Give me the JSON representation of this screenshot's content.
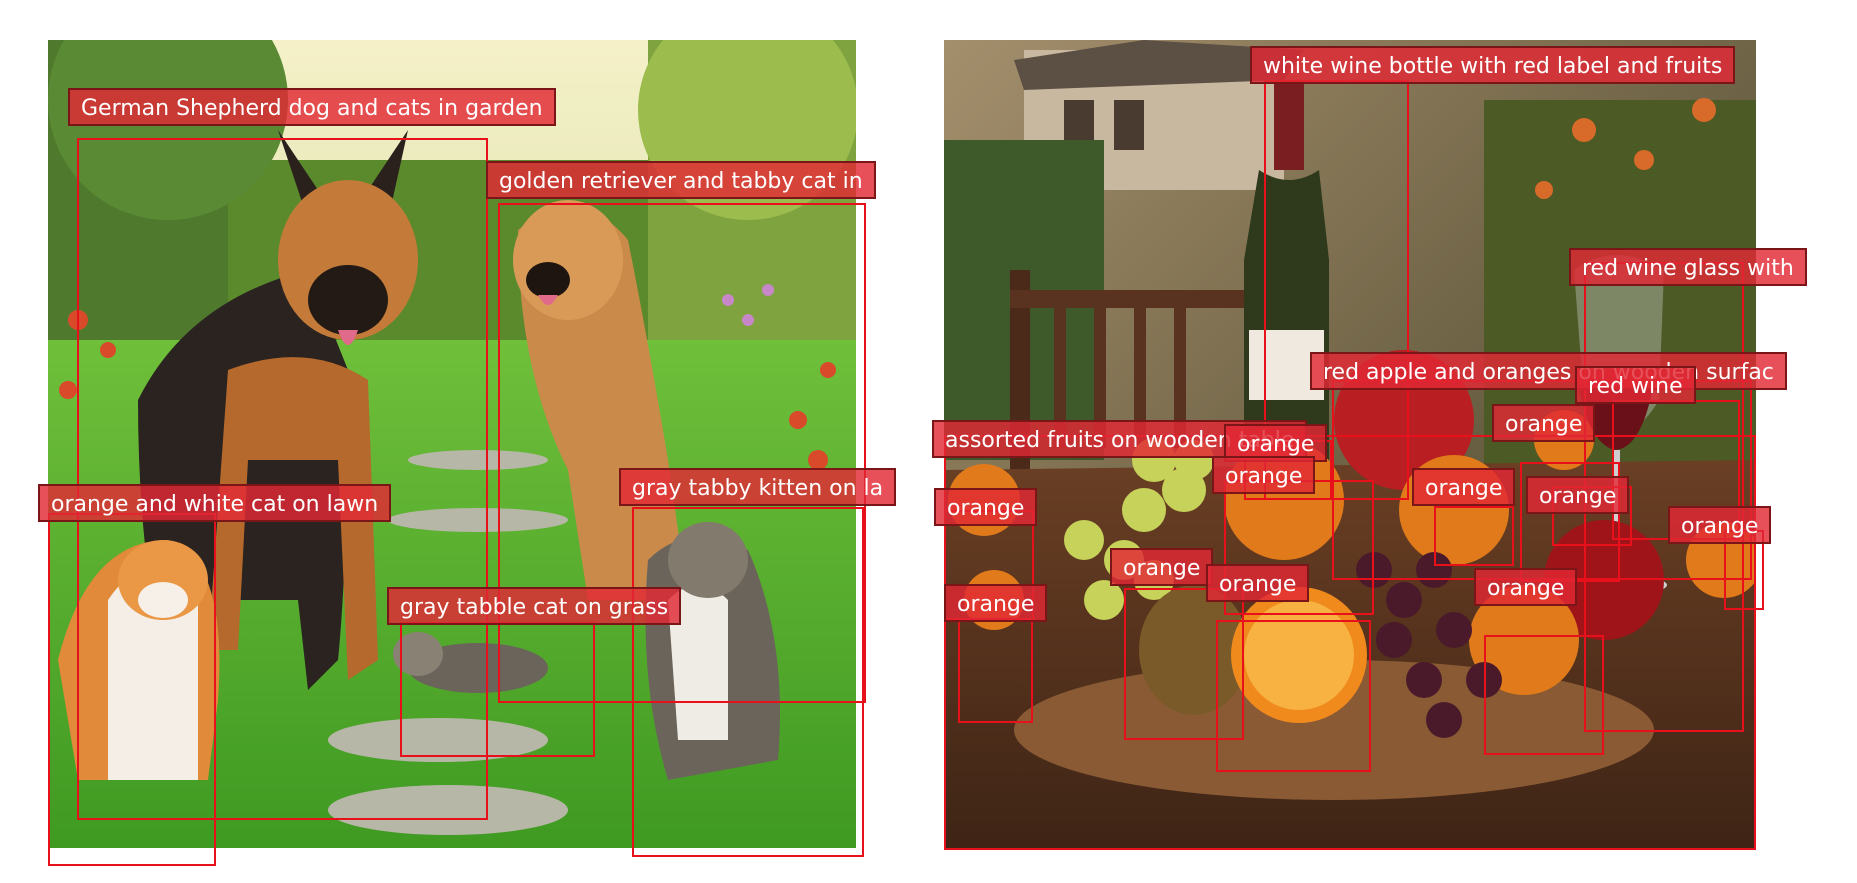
{
  "panels": [
    {
      "name": "left-image",
      "labels": [
        "German Shepherd dog and cats in garden",
        "golden retriever and tabby cat in",
        "orange and white cat on lawn",
        "gray tabby kitten on la",
        "gray tabble cat on grass"
      ]
    },
    {
      "name": "right-image",
      "labels": [
        "white wine bottle with red label and fruits",
        "red wine glass with",
        "red apple and oranges on wooden surfac",
        "red wine",
        "assorted fruits on wooden table",
        "orange",
        "orange",
        "orange",
        "orange",
        "orange",
        "orange",
        "orange",
        "orange",
        "orange",
        "orange",
        "orange"
      ]
    }
  ],
  "colors": {
    "box": "#e8101a",
    "label_bg": "#e22834"
  }
}
